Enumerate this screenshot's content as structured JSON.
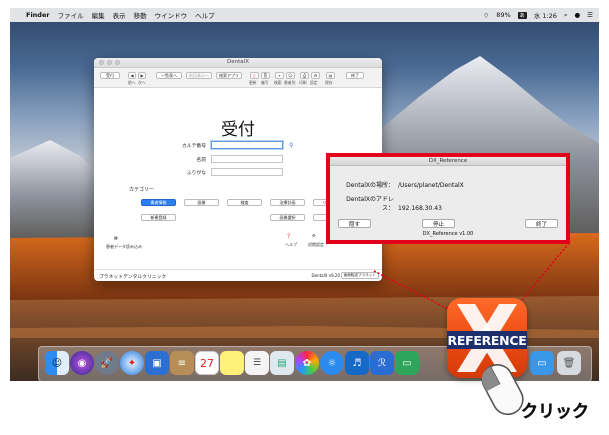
{
  "menubar": {
    "app": "Finder",
    "items": [
      "ファイル",
      "編集",
      "表示",
      "移動",
      "ウインドウ",
      "ヘルプ"
    ],
    "battery_badge": "89%",
    "input_badge": "あ",
    "clock": "水 1:26"
  },
  "dentalx": {
    "window_title": "DentalX",
    "toolbar": {
      "buttons": [
        "受付",
        "一覧表へ",
        "前回表示へ",
        "検索アプリ",
        "終了"
      ],
      "labels": [
        "更新",
        "前へ",
        "次へ",
        "削除",
        "複写",
        "検索",
        "患者別",
        "印刷",
        "設定",
        "保存"
      ]
    },
    "form_title": "受付",
    "fields": {
      "karte_label": "カルテ番号",
      "name_label": "名前",
      "furigana_label": "ふりがな"
    },
    "category_label": "カテゴリー",
    "category_buttons_row1": [
      "患者情報",
      "画像",
      "検査",
      "治療計画",
      "リスク判"
    ],
    "category_buttons_row2": [
      "新患登録",
      "画像選択",
      "症例"
    ],
    "bottom_left_label": "患者データ読み込み",
    "bottom_icons": [
      "ヘルプ",
      "初期設定"
    ],
    "clinic_name": "プラネットデンタルクリニック",
    "version": "DentalX v9.20",
    "status_button": "画面転送プラネット"
  },
  "dx_reference": {
    "title": "DX_Reference",
    "location_label": "DentalXの場所：",
    "location_value": "/Users/planet/DentalX",
    "address_label": "DentalXのアドレス：",
    "address_value": "192.168.30.43",
    "hide_button": "隠す",
    "stop_button": "停止",
    "quit_button": "終了",
    "version": "DX_Reference v1.00"
  },
  "dock": {
    "items": [
      "finder-icon",
      "siri-icon",
      "launchpad-icon",
      "safari-icon",
      "preview-icon",
      "notes-icon",
      "calendar-icon",
      "stickies-icon",
      "reminders-icon",
      "photos-icon",
      "music-icon",
      "facetime-icon",
      "app-store-icon",
      "dx-reference-icon",
      "folder-icon",
      "trash-icon"
    ],
    "calendar_day": "27"
  },
  "big_icon_label": "REFERENCE",
  "callout_text": "クリック",
  "colors": {
    "highlight": "#e3001b",
    "primary_button": "#2b7ff0",
    "reference_orange": "#ec4a12",
    "reference_navy": "#1e2f6e"
  }
}
